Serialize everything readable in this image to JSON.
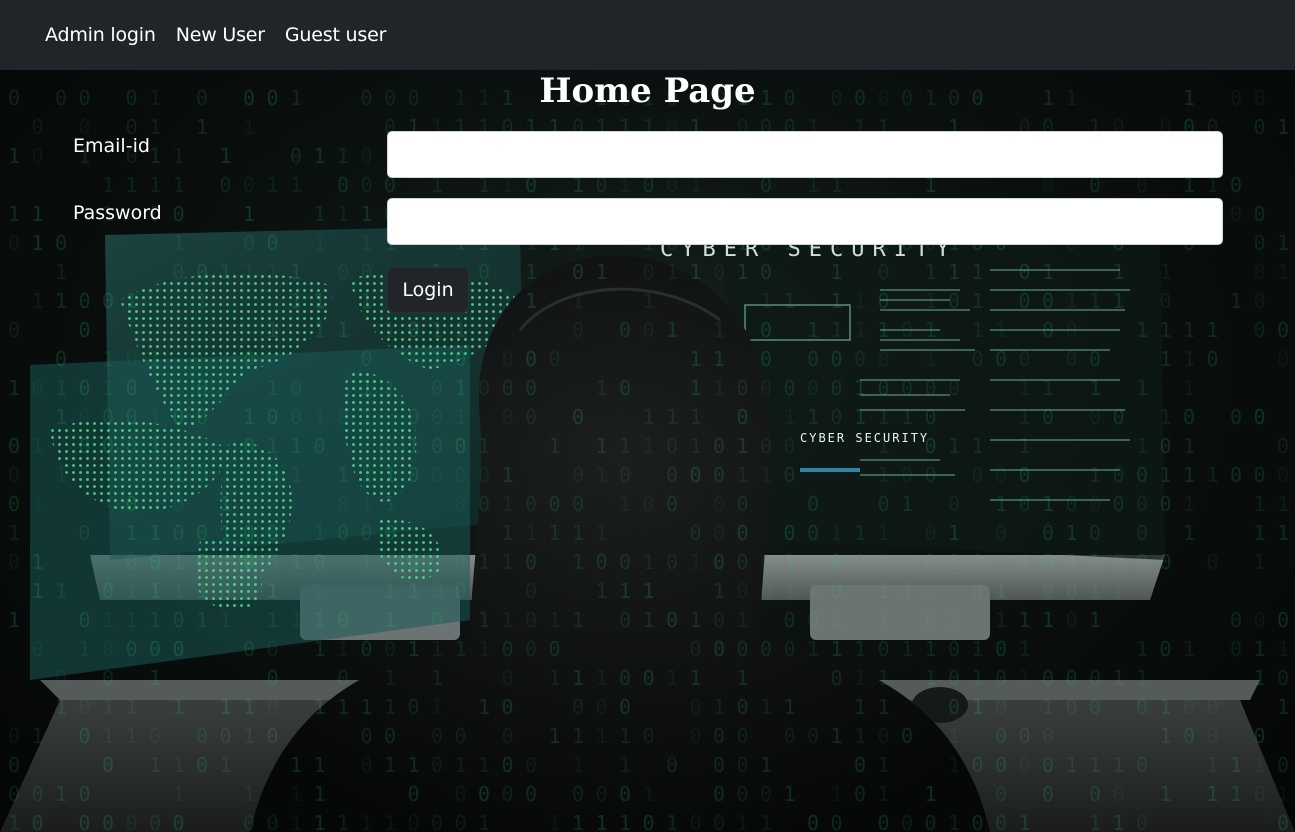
{
  "navbar": {
    "links": [
      {
        "label": "Admin login"
      },
      {
        "label": "New User"
      },
      {
        "label": "Guest user"
      }
    ]
  },
  "page": {
    "title": "Home Page"
  },
  "form": {
    "email_label": "Email-id",
    "email_value": "",
    "password_label": "Password",
    "password_value": "",
    "login_label": "Login"
  },
  "background": {
    "screen_text_top": "CYBER SECURITY",
    "screen_text_mid": "CYBER SECURITY",
    "accent_color": "#2ecc71",
    "nav_color": "#212529"
  }
}
